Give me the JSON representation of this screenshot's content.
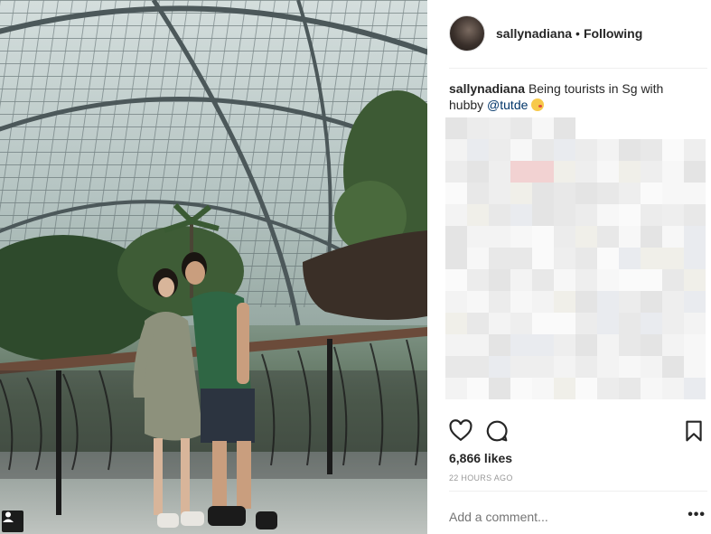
{
  "header": {
    "username": "sallynadiana",
    "separator": "•",
    "follow_state": "Following"
  },
  "caption": {
    "username": "sallynadiana",
    "text": "Being tourists in Sg with hubby",
    "mention": "@tutde"
  },
  "actions": {
    "like_icon": "heart-icon",
    "comment_icon": "comment-icon",
    "save_icon": "bookmark-icon"
  },
  "stats": {
    "likes": "6,866 likes",
    "timestamp": "22 HOURS AGO"
  },
  "comment": {
    "placeholder": "Add a comment...",
    "options_label": "•••"
  }
}
